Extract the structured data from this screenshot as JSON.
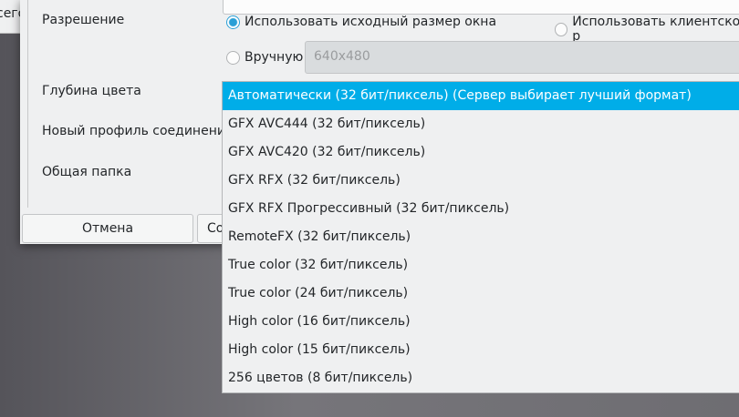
{
  "background_window": {
    "partial_text": "сего"
  },
  "dialog": {
    "resolution_label": "Разрешение",
    "radio_original": "Использовать исходный размер окна",
    "radio_client": "Использовать клиентское р",
    "radio_manual": "Вручную",
    "manual_value": "640x480",
    "color_depth_label": "Глубина цвета",
    "new_profile_label": "Новый профиль соединения",
    "shared_folder_label": "Общая папка",
    "cancel": "Отмена",
    "save_partial": "Со"
  },
  "dropdown": {
    "selected_index": 0,
    "items": [
      "Автоматически (32 бит/пиксель) (Сервер выбирает лучший формат)",
      "GFX AVC444 (32 бит/пиксель)",
      "GFX AVC420 (32 бит/пиксель)",
      "GFX RFX (32 бит/пиксель)",
      "GFX RFX Прогрессивный (32 бит/пиксель)",
      "RemoteFX (32 бит/пиксель)",
      "True color (32 бит/пиксель)",
      "True color (24 бит/пиксель)",
      "High color (16 бит/пиксель)",
      "High color (15 бит/пиксель)",
      "256 цветов (8 бит/пиксель)"
    ]
  },
  "colors": {
    "accent": "#00ade8"
  }
}
